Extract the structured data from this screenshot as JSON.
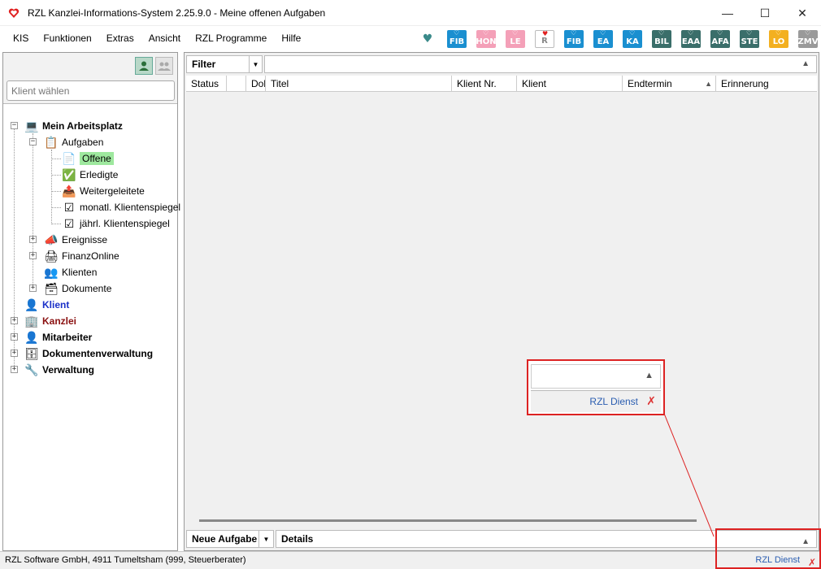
{
  "window": {
    "title": "RZL Kanzlei-Informations-System 2.25.9.0 - Meine offenen Aufgaben",
    "controls": [
      "minimize",
      "maximize",
      "close"
    ]
  },
  "menu": [
    "KIS",
    "Funktionen",
    "Extras",
    "Ansicht",
    "RZL Programme",
    "Hilfe"
  ],
  "programs": [
    {
      "label": "",
      "color": "#ffffff",
      "icon": "heart-link-icon"
    },
    {
      "label": "FIB",
      "color": "#1a8fd0"
    },
    {
      "label": "HON",
      "color": "#f4a0b8"
    },
    {
      "label": "LE",
      "color": "#f4a0b8"
    },
    {
      "label": "R",
      "color": "#ffffff"
    },
    {
      "label": "FIB",
      "color": "#1a8fd0"
    },
    {
      "label": "EA",
      "color": "#1a8fd0"
    },
    {
      "label": "KA",
      "color": "#1a8fd0"
    },
    {
      "label": "BIL",
      "color": "#3a6e6a"
    },
    {
      "label": "EAA",
      "color": "#3a6e6a"
    },
    {
      "label": "AFA",
      "color": "#3a6e6a"
    },
    {
      "label": "STE",
      "color": "#3a6e6a"
    },
    {
      "label": "LO",
      "color": "#f3b020"
    },
    {
      "label": "ZMV",
      "color": "#9a9a9a"
    }
  ],
  "left": {
    "client_placeholder": "Klient wählen",
    "tree": {
      "arbeitsplatz": "Mein Arbeitsplatz",
      "aufgaben": "Aufgaben",
      "offene": "Offene",
      "erledigte": "Erledigte",
      "weitergeleitete": "Weitergeleitete",
      "monatl": "monatl. Klientenspiegel",
      "jaehrl": "jährl. Klientenspiegel",
      "ereignisse": "Ereignisse",
      "finanzonline": "FinanzOnline",
      "klienten": "Klienten",
      "dokumente": "Dokumente",
      "klient": "Klient",
      "kanzlei": "Kanzlei",
      "mitarbeiter": "Mitarbeiter",
      "dokumentenverwaltung": "Dokumentenverwaltung",
      "verwaltung": "Verwaltung"
    }
  },
  "main": {
    "filter_label": "Filter",
    "columns": [
      "Status",
      "",
      "Dok",
      "Titel",
      "Klient Nr.",
      "Klient",
      "Endtermin",
      "Erinnerung"
    ],
    "new_task": "Neue Aufgabe",
    "details": "Details"
  },
  "status": {
    "left": "RZL Software GmbH, 4911 Tumeltsham (999, Steuerberater)",
    "right": "RZL Dienst"
  },
  "callout": {
    "label": "RZL Dienst"
  }
}
